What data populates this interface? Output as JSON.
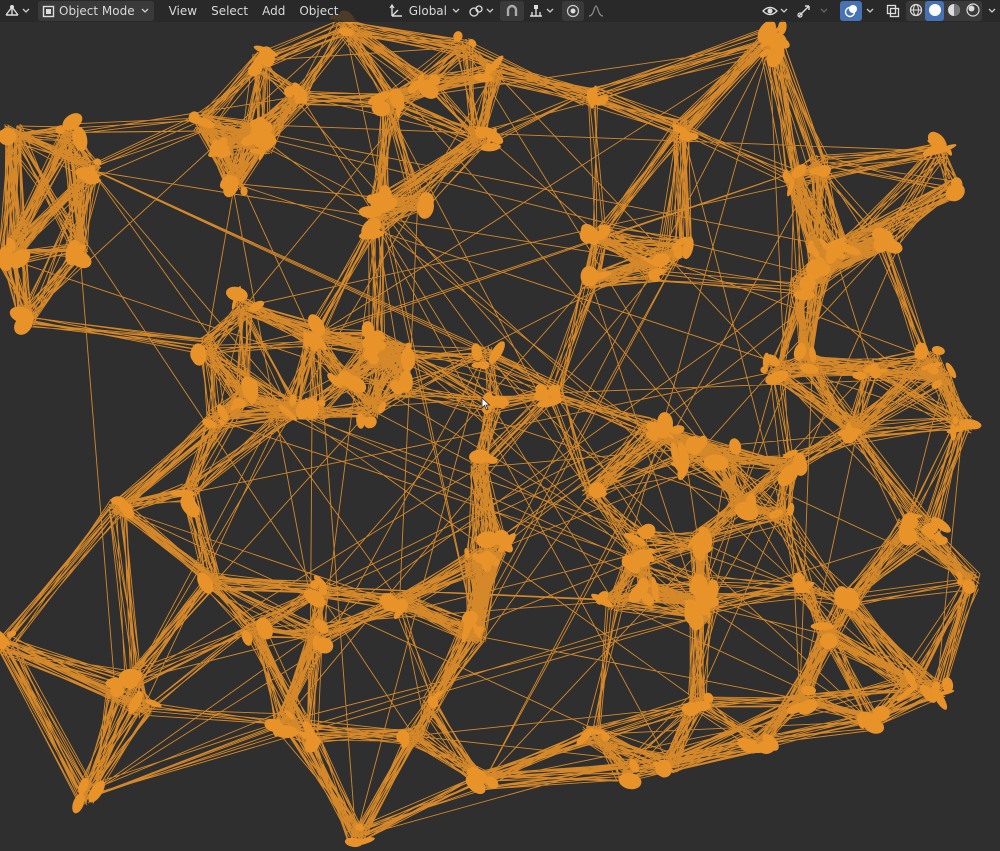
{
  "header": {
    "editor_type_icon": "3d-viewport-icon",
    "mode": {
      "label": "Object Mode",
      "icon": "object-mode-icon"
    },
    "menus": [
      {
        "label": "View"
      },
      {
        "label": "Select"
      },
      {
        "label": "Add"
      },
      {
        "label": "Object"
      }
    ],
    "transform_orientation": {
      "label": "Global",
      "icon": "transform-orientation-icon"
    },
    "pivot_icon": "pivot-point-icon",
    "snap_icon": "snap-magnet-icon",
    "snap_target_icon": "snap-increment-icon",
    "proportional_icon": "proportional-editing-icon",
    "falloff_icon": "falloff-curve-icon",
    "visibility_icon": "eye-icon",
    "gizmo_icon": "gizmo-icon",
    "overlay_icon": "overlays-icon",
    "xray_icon": "xray-icon",
    "shading_modes": [
      "wireframe",
      "solid",
      "material-preview",
      "rendered"
    ],
    "active_shading": "solid"
  },
  "viewport": {
    "background_color": "#2f2f2f",
    "wire_color": "#e8922a"
  }
}
